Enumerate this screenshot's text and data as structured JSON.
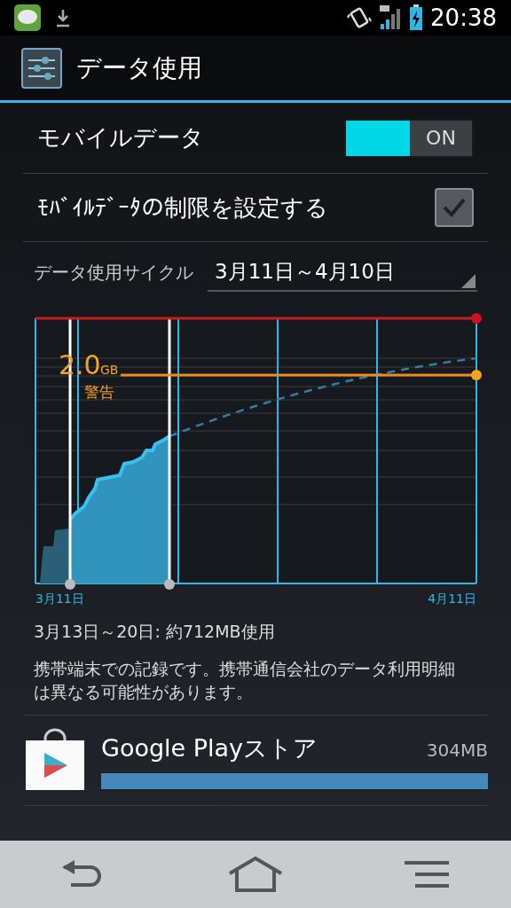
{
  "status_bar": {
    "time": "20:38"
  },
  "action_bar": {
    "title": "データ使用"
  },
  "settings": [
    {
      "kind": "toggle",
      "label": "モバイルデータ",
      "on": true,
      "state_text": "ON"
    },
    {
      "kind": "checkbox",
      "label": "ﾓﾊﾞｲﾙﾃﾞｰﾀの制限を設定する",
      "checked": true
    }
  ],
  "cycle": {
    "label": "データ使用サイクル",
    "value": "3月11日～4月10日"
  },
  "chart": {
    "warning_value": "2.0",
    "warning_unit": "GB",
    "warning_label": "警告",
    "start_label": "3月11日",
    "end_label": "4月11日"
  },
  "summary": "3月13日～20日: 約712MB使用",
  "note": "携帯端末での記録です。携帯通信会社のデータ利用明細は異なる可能性があります。",
  "apps": [
    {
      "name": "Google Playストア",
      "usage": "304MB",
      "level": 1
    }
  ]
}
